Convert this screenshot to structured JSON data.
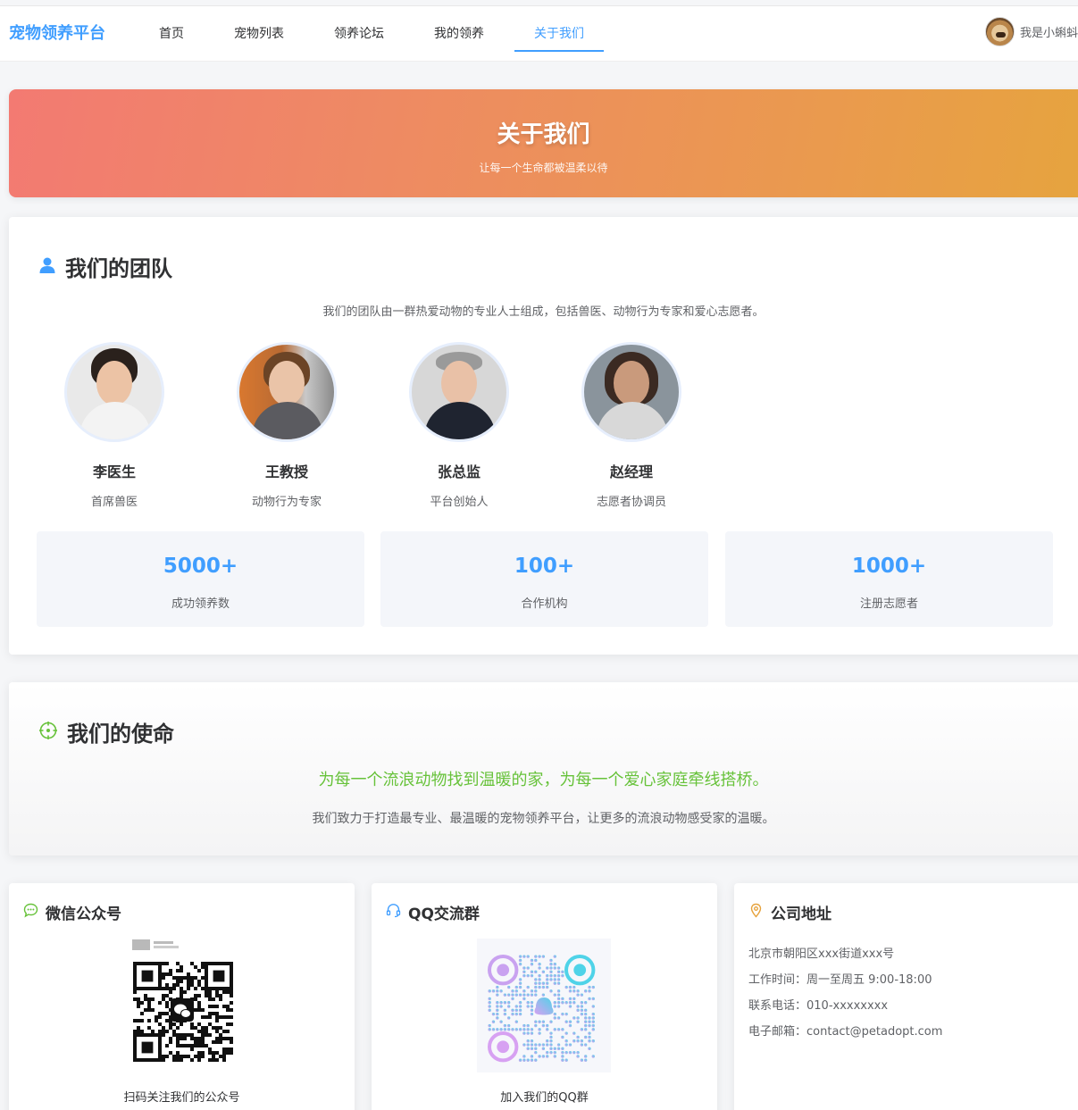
{
  "header": {
    "brand": "宠物领养平台",
    "nav": [
      "首页",
      "宠物列表",
      "领养论坛",
      "我的领养",
      "关于我们"
    ],
    "active_index": 4,
    "user_name": "我是小蝌蚪"
  },
  "hero": {
    "title": "关于我们",
    "subtitle": "让每一个生命都被温柔以待"
  },
  "team": {
    "title": "我们的团队",
    "description": "我们的团队由一群热爱动物的专业人士组成，包括兽医、动物行为专家和爱心志愿者。",
    "members": [
      {
        "name": "李医生",
        "role": "首席兽医"
      },
      {
        "name": "王教授",
        "role": "动物行为专家"
      },
      {
        "name": "张总监",
        "role": "平台创始人"
      },
      {
        "name": "赵经理",
        "role": "志愿者协调员"
      }
    ],
    "stats": [
      {
        "value": "5000+",
        "label": "成功领养数"
      },
      {
        "value": "100+",
        "label": "合作机构"
      },
      {
        "value": "1000+",
        "label": "注册志愿者"
      }
    ]
  },
  "mission": {
    "title": "我们的使命",
    "quote": "为每一个流浪动物找到温暖的家，为每一个爱心家庭牵线搭桥。",
    "description": "我们致力于打造最专业、最温暖的宠物领养平台，让更多的流浪动物感受家的温暖。"
  },
  "wechat": {
    "title": "微信公众号",
    "caption": "扫码关注我们的公众号"
  },
  "qq": {
    "title": "QQ交流群",
    "caption": "加入我们的QQ群"
  },
  "address": {
    "title": "公司地址",
    "lines": [
      "北京市朝阳区xxx街道xxx号",
      "工作时间：周一至周五 9:00-18:00",
      "联系电话：010-xxxxxxxx",
      "电子邮箱：contact@petadopt.com"
    ]
  },
  "colors": {
    "primary": "#409eff",
    "mission_green": "#67c23a",
    "address_orange": "#e6a23c"
  }
}
